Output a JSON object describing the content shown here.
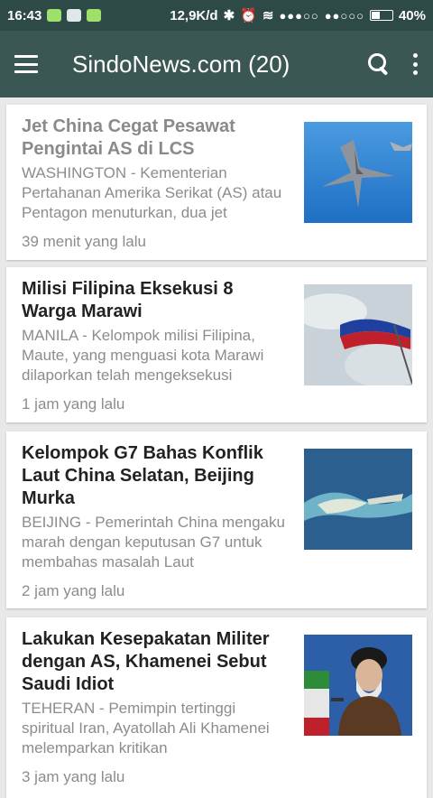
{
  "status_bar": {
    "time": "16:43",
    "speed": "12,9K/d",
    "signal1": "●●●○○",
    "signal2": "●●○○○",
    "battery": "40%"
  },
  "app_bar": {
    "title": "SindoNews.com (20)"
  },
  "articles": [
    {
      "headline": "Jet China Cegat Pesawat Pengintai AS di LCS",
      "summary": "WASHINGTON - Kementerian Pertahanan Amerika Serikat (AS) atau Pentagon menuturkan, dua jet",
      "time": "39 menit yang lalu",
      "read": true
    },
    {
      "headline": "Milisi Filipina Eksekusi 8 Warga Marawi",
      "summary": "MANILA - Kelompok milisi Filipina, Maute, yang menguasi kota Marawi dilaporkan telah mengeksekusi",
      "time": "1 jam yang lalu",
      "read": false
    },
    {
      "headline": "Kelompok G7 Bahas Konflik Laut China Selatan, Beijing Murka",
      "summary": "BEIJING - Pemerintah China mengaku marah dengan keputusan G7 untuk membahas masalah Laut",
      "time": "2 jam yang lalu",
      "read": false
    },
    {
      "headline": "Lakukan Kesepakatan Militer dengan AS, Khamenei Sebut Saudi Idiot",
      "summary": "TEHERAN - Pemimpin tertinggi spiritual Iran, Ayatollah Ali Khamenei melemparkan kritikan",
      "time": "3 jam yang lalu",
      "read": false
    }
  ],
  "colors": {
    "status_bar": "#2e4a46",
    "app_bar": "#3b5753",
    "background": "#e8e8e8"
  }
}
